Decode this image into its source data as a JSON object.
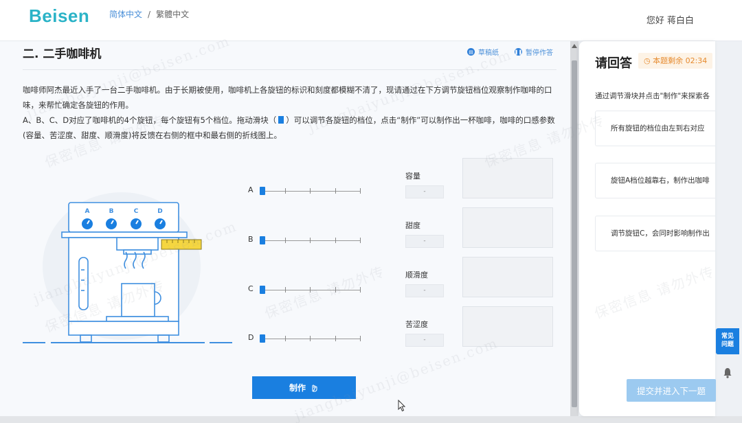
{
  "header": {
    "logo": "Beisen",
    "lang_simplified": "简体中文",
    "lang_separator": "/",
    "lang_traditional": "繁體中文",
    "greeting": "您好 蒋白白"
  },
  "question": {
    "title": "二. 二手咖啡机",
    "draft_label": "草稿纸",
    "pause_label": "暂停作答",
    "desc_line1": "咖啡师阿杰最近入手了一台二手咖啡机。由于长期被使用，咖啡机上各旋钮的标识和刻度都模糊不清了，现请通过在下方调节旋钮档位观察制作咖啡的口味，来帮忙确定各旋钮的作用。",
    "desc_line2_a": "A、B、C、D对应了咖啡机的4个旋钮，每个旋钮有5个档位。拖动滑块（",
    "desc_line2_b": "）可以调节各旋钮的档位，点击“制作”可以制作出一杯咖啡，咖啡的口感参数(容量、苦涩度、甜度、顺滑度)将反馈在右侧的框中和最右侧的折线图上。",
    "knob_labels": [
      "A",
      "B",
      "C",
      "D"
    ],
    "sliders": [
      {
        "label": "A",
        "level": 1
      },
      {
        "label": "B",
        "level": 1
      },
      {
        "label": "C",
        "level": 1
      },
      {
        "label": "D",
        "level": 1
      }
    ],
    "outputs": [
      {
        "label": "容量",
        "value": "-"
      },
      {
        "label": "甜度",
        "value": "-"
      },
      {
        "label": "顺滑度",
        "value": "-"
      },
      {
        "label": "苦涩度",
        "value": "-"
      }
    ],
    "make_button": "制作"
  },
  "answer_panel": {
    "title": "请回答",
    "timer": "本题剩余 02:34",
    "instruction": "通过调节滑块并点击\"制作\"来探索各",
    "cards": [
      "所有旋钮的档位由左到右对应",
      "旋钮A档位越靠右，制作出咖啡",
      "调节旋钮C，会同时影响制作出"
    ],
    "submit_button": "提交并进入下一题"
  },
  "floating": {
    "faq_line1": "常见",
    "faq_line2": "问题"
  },
  "watermark": {
    "text1": "jiangbaiyunji@beisen.com",
    "text2": "保密信息 请勿外传"
  },
  "colors": {
    "accent": "#1a7fe0",
    "logo": "#2bb3c7",
    "timer": "#e68a2e",
    "submit_disabled": "#9ccaf0"
  }
}
